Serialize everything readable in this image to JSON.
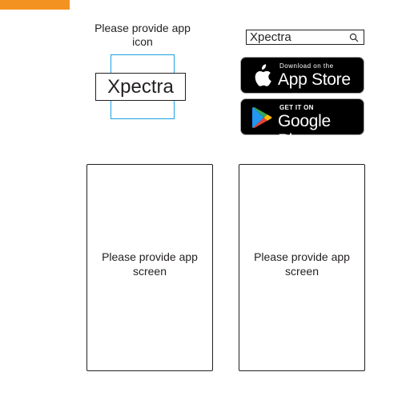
{
  "header": {
    "accent_color": "#f39220"
  },
  "app_icon": {
    "prompt": "Please provide app icon",
    "app_name": "Xpectra",
    "frame_color": "#1ca3de"
  },
  "search": {
    "query": "Xpectra",
    "icon": "search-icon"
  },
  "badges": {
    "app_store": {
      "small_text": "Download on the",
      "large_text": "App Store",
      "icon": "apple-icon"
    },
    "google_play": {
      "small_text": "GET IT ON",
      "large_text": "Google Play",
      "icon": "google-play-icon"
    }
  },
  "screens": [
    {
      "label": "Please provide app screen"
    },
    {
      "label": "Please provide app screen"
    }
  ]
}
